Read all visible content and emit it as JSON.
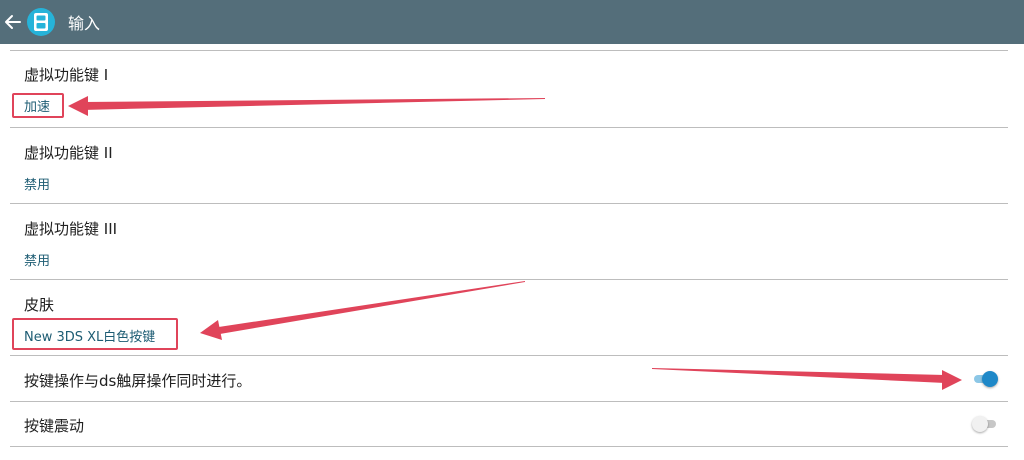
{
  "header": {
    "title": "输入",
    "back_icon": "arrow-back-icon",
    "app_icon": "app-logo-icon",
    "background": "#546e7a"
  },
  "prefs": {
    "vkey1": {
      "title": "虚拟功能键 I",
      "summary": "加速"
    },
    "vkey2": {
      "title": "虚拟功能键 II",
      "summary": "禁用"
    },
    "vkey3": {
      "title": "虚拟功能键 III",
      "summary": "禁用"
    },
    "skin": {
      "title": "皮肤",
      "summary": "New 3DS XL白色按键"
    },
    "simultaneous": {
      "title": "按键操作与ds触屏操作同时进行。",
      "enabled": true
    },
    "vibration": {
      "title": "按键震动",
      "enabled": false
    }
  },
  "colors": {
    "summary_text": "#1d5c73",
    "switch_on": "#1e88c8",
    "switch_off": "#f1f1f1",
    "annotation": "#e0445a"
  }
}
